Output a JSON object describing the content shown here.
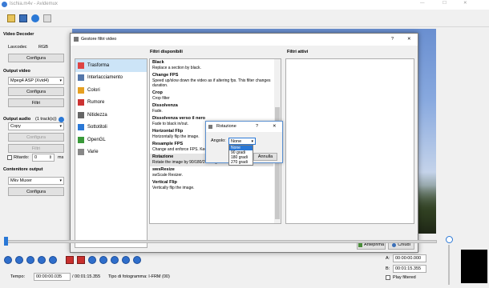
{
  "window": {
    "title": "Ischia.m4v - Avidemux"
  },
  "left": {
    "video_decoder": {
      "heading": "Video Decoder",
      "codec_label": "Lavcodec",
      "codec_value": "RGB",
      "configure": "Configura"
    },
    "output_video": {
      "heading": "Output video",
      "codec": "Mpeg4 ASP (Xvid4)",
      "configure": "Configura",
      "filters": "Filtri"
    },
    "output_audio": {
      "heading": "Output audio",
      "tracks": "(1 track(s))",
      "mode": "Copy",
      "configure": "Configura",
      "filters": "Filtri",
      "delay_label": "Ritardo:",
      "delay_value": "0",
      "unit": "ms"
    },
    "container": {
      "heading": "Contenitore output",
      "format": "Mkv Muxer",
      "configure": "Configura"
    }
  },
  "filter_manager": {
    "title": "Gestore filtri video",
    "help": "?",
    "available_heading": "Filtri disponibili",
    "active_heading": "Filtri attivi",
    "categories": [
      {
        "name": "Trasforma",
        "icon": "transform-icon"
      },
      {
        "name": "Interlacciamento",
        "icon": "interlace-icon"
      },
      {
        "name": "Colori",
        "icon": "colors-icon"
      },
      {
        "name": "Rumore",
        "icon": "noise-icon"
      },
      {
        "name": "Nitidezza",
        "icon": "sharpness-icon"
      },
      {
        "name": "Sottotitoli",
        "icon": "subtitles-icon"
      },
      {
        "name": "OpenGL",
        "icon": "opengl-icon"
      },
      {
        "name": "Varie",
        "icon": "misc-icon"
      }
    ],
    "filters": [
      {
        "name": "Black",
        "desc": "Replace a section by black."
      },
      {
        "name": "Change FPS",
        "desc": "Speed up/slow down the video as if altering fps. This filter changes duration."
      },
      {
        "name": "Crop",
        "desc": "Crop filter"
      },
      {
        "name": "Dissolvenza",
        "desc": "Fade."
      },
      {
        "name": "Dissolvenza verso il nero",
        "desc": "Fade to black in/out."
      },
      {
        "name": "Horizontal Flip",
        "desc": "Horizontally flip the image."
      },
      {
        "name": "Resample FPS",
        "desc": "Change and enforce FPS. Keep duration and sync."
      },
      {
        "name": "Rotazione",
        "desc": "Rotate the image by 90/180/270 degrees."
      },
      {
        "name": "swsResize",
        "desc": "swScale Resizer."
      },
      {
        "name": "Vertical Flip",
        "desc": "Vertically flip the image."
      }
    ],
    "preview": "Anteprima",
    "close": "Chiudi"
  },
  "rotation_dialog": {
    "title": "Rotazione",
    "help": "?",
    "close": "✕",
    "angle_label": "Angolo:",
    "angle_value": "None",
    "options": [
      "None",
      "90 gradi",
      "180 gradi",
      "270 gradi"
    ],
    "cancel": "Annulla"
  },
  "bottom": {
    "time_label": "Tempo:",
    "time_value": "00:00:00.035",
    "duration": "/ 00:01:15.355",
    "frame_type": "Tipo di fotogramma:  I-FRM (00)",
    "a_label": "A:",
    "a_value": "00:00:00.000",
    "b_label": "B:",
    "b_value": "00:01:15.355",
    "play_filtered": "Play filtered"
  }
}
